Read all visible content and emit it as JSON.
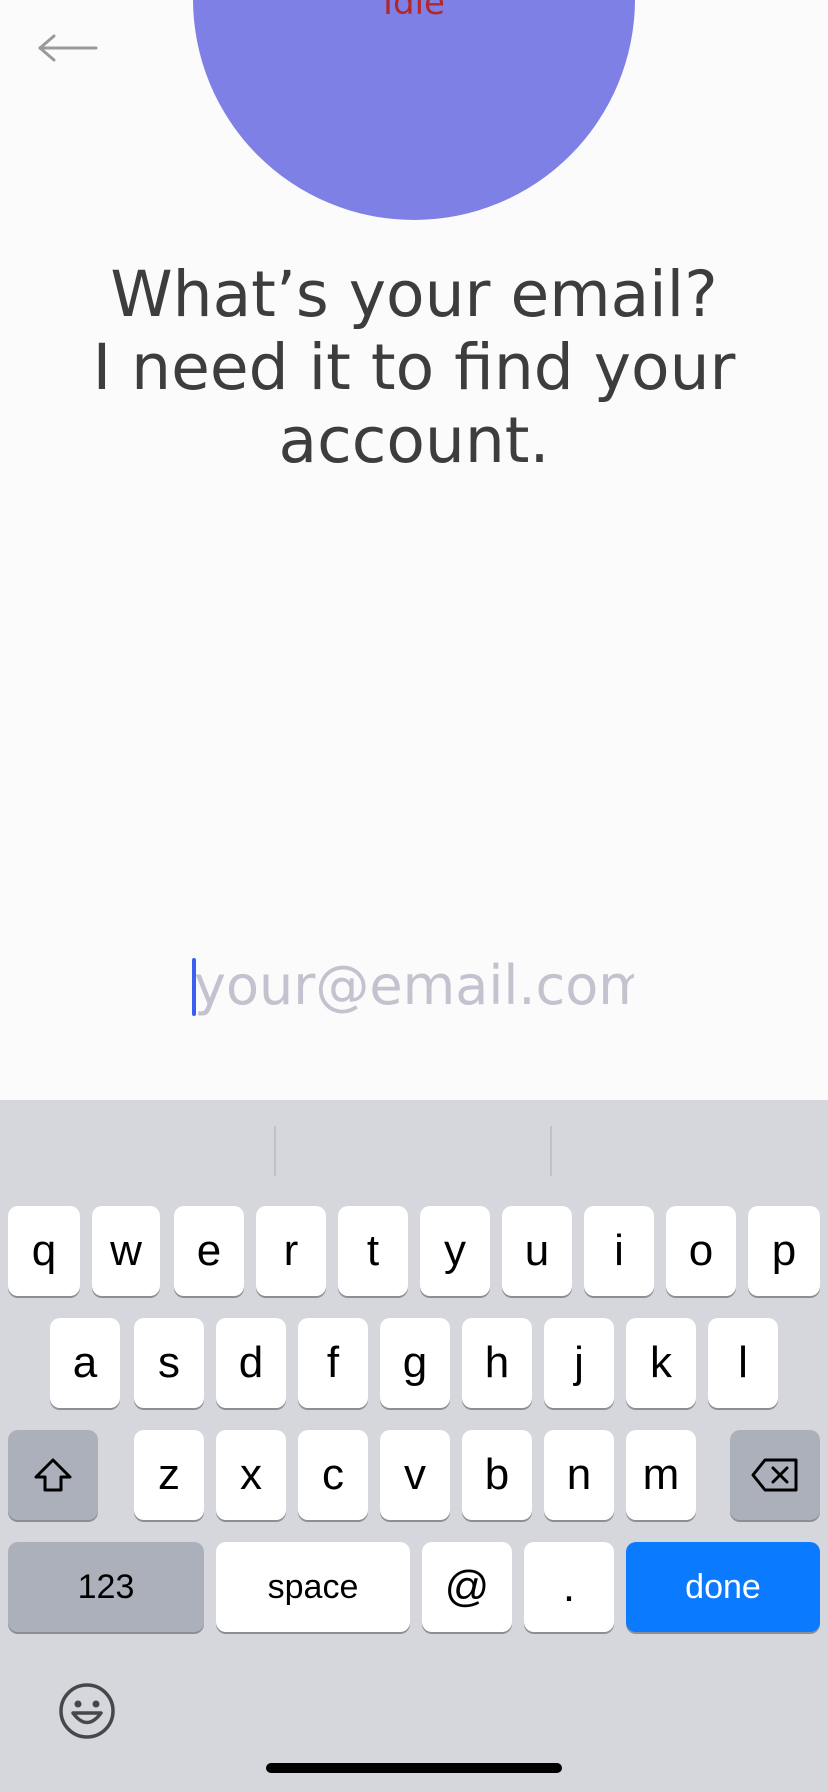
{
  "avatar": {
    "status": "Idle",
    "color": "#7f80e5",
    "status_color": "#b0282c"
  },
  "prompt": {
    "line1": "What’s your email?",
    "line2": "I need it to find your",
    "line3": "account."
  },
  "email": {
    "value": "",
    "placeholder": "your@email.com"
  },
  "keyboard": {
    "row1": [
      "q",
      "w",
      "e",
      "r",
      "t",
      "y",
      "u",
      "i",
      "o",
      "p"
    ],
    "row2": [
      "a",
      "s",
      "d",
      "f",
      "g",
      "h",
      "j",
      "k",
      "l"
    ],
    "row3": [
      "z",
      "x",
      "c",
      "v",
      "b",
      "n",
      "m"
    ],
    "numbers_label": "123",
    "space_label": "space",
    "at_label": "@",
    "dot_label": ".",
    "done_label": "done",
    "accent": "#0a7aff"
  },
  "icons": {
    "back": "back-arrow-icon",
    "shift": "shift-icon",
    "delete": "delete-icon",
    "emoji": "emoji-icon"
  }
}
